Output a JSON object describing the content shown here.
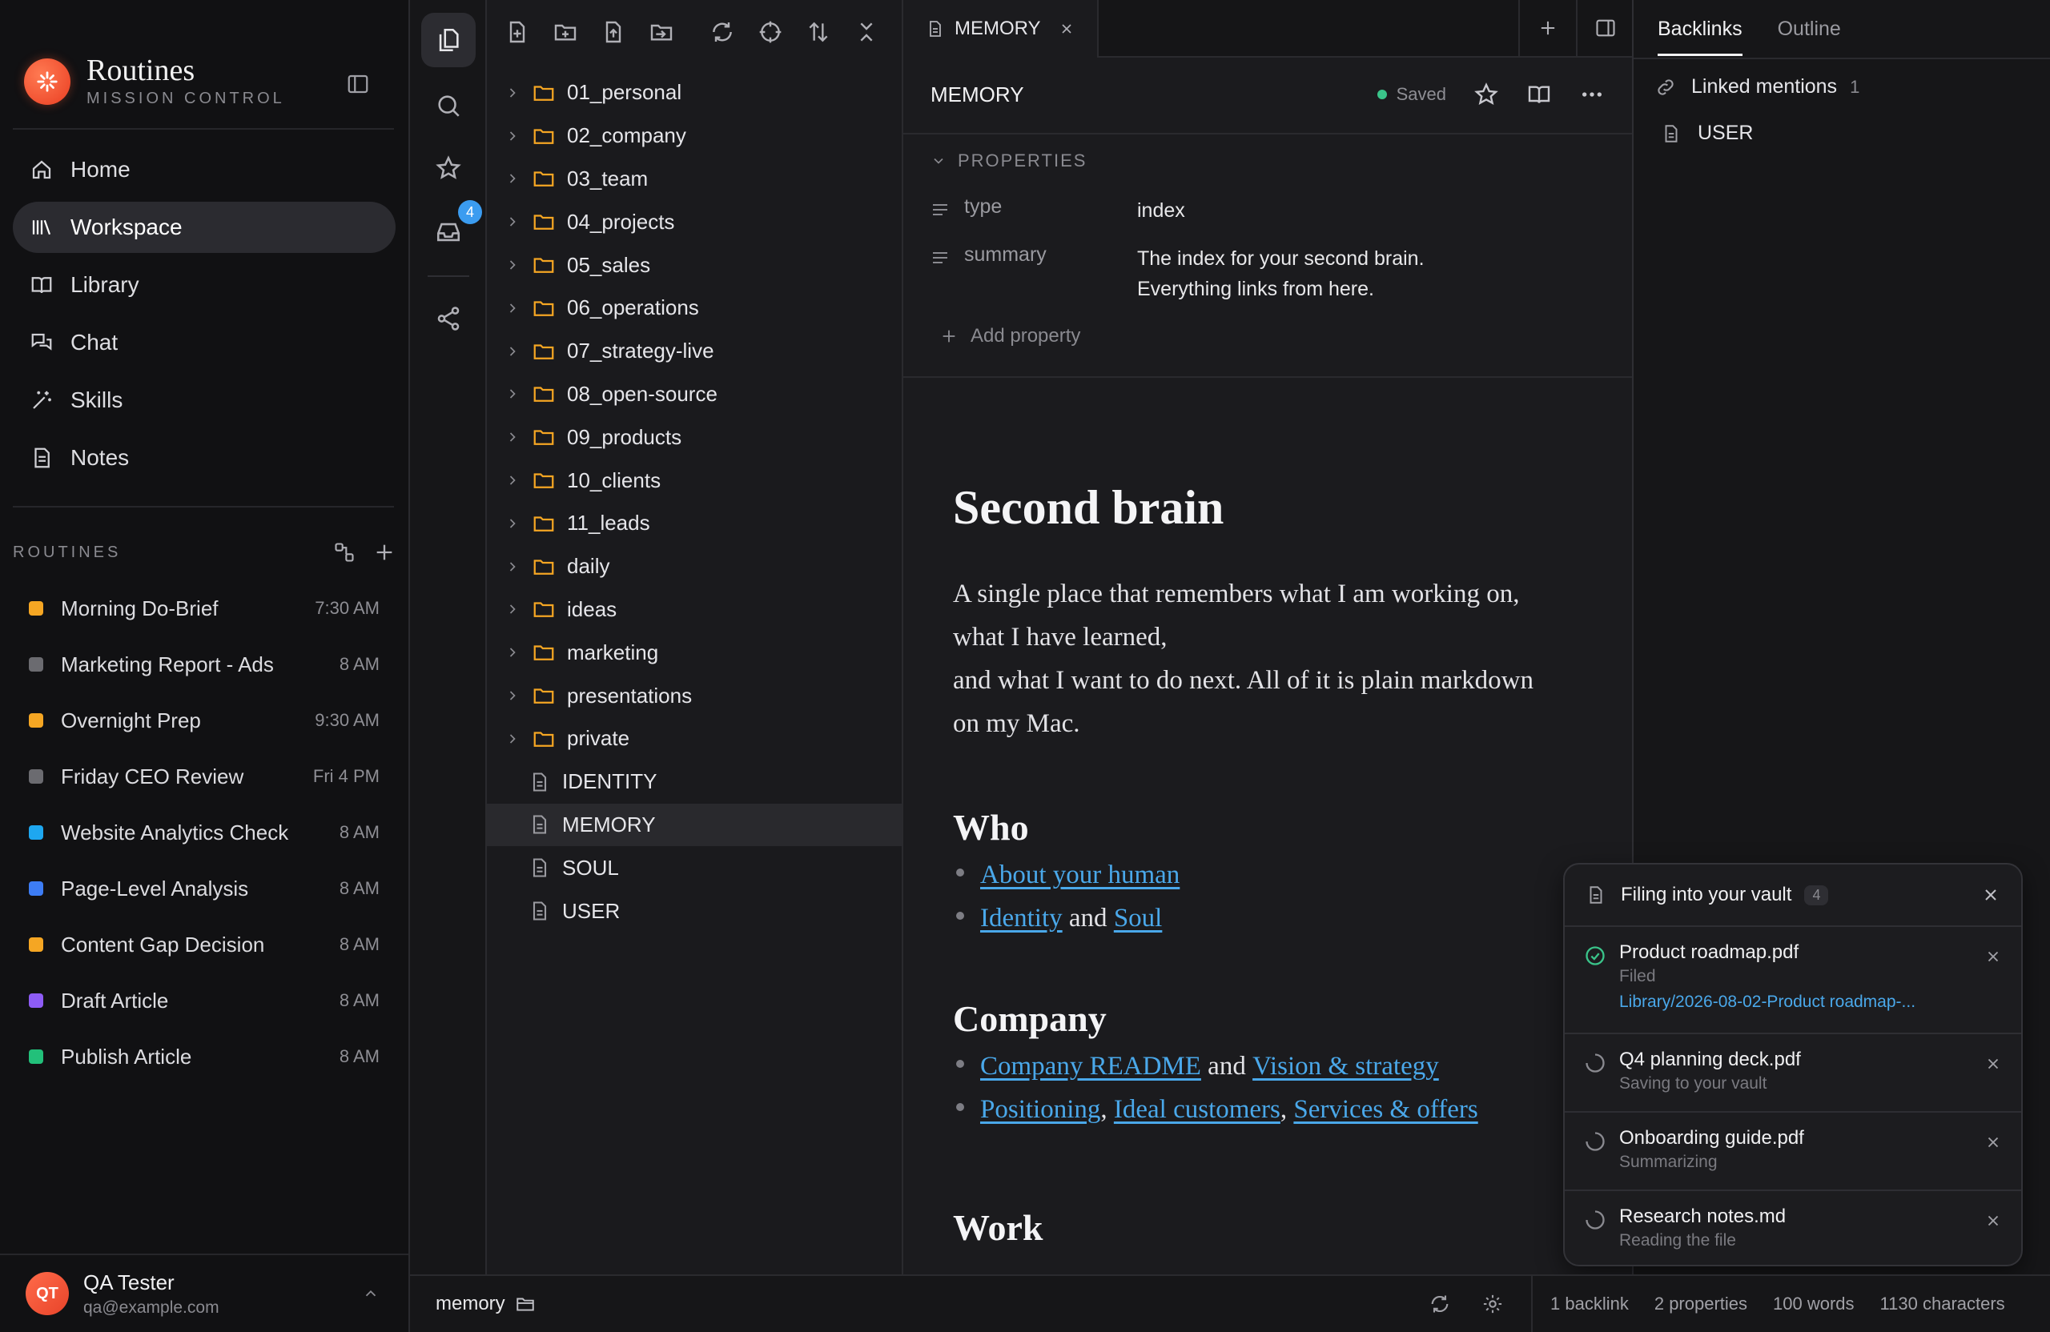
{
  "brand": {
    "title": "Routines",
    "subtitle": "MISSION CONTROL"
  },
  "nav": [
    {
      "label": "Home",
      "icon": "home-icon"
    },
    {
      "label": "Workspace",
      "icon": "library-books-icon",
      "active": true
    },
    {
      "label": "Library",
      "icon": "book-open-icon"
    },
    {
      "label": "Chat",
      "icon": "chat-bubbles-icon"
    },
    {
      "label": "Skills",
      "icon": "magic-wand-icon"
    },
    {
      "label": "Notes",
      "icon": "note-document-icon"
    }
  ],
  "routines": {
    "title": "ROUTINES",
    "items": [
      {
        "name": "Morning Do-Brief",
        "time": "7:30 AM",
        "color": "#f5a623"
      },
      {
        "name": "Marketing Report - Ads",
        "time": "8 AM",
        "color": "#6b6b70"
      },
      {
        "name": "Overnight Prep",
        "time": "9:30 AM",
        "color": "#f5a623"
      },
      {
        "name": "Friday CEO Review",
        "time": "Fri 4 PM",
        "color": "#6b6b70"
      },
      {
        "name": "Website Analytics Check",
        "time": "8 AM",
        "color": "#1ea7f0"
      },
      {
        "name": "Page-Level Analysis",
        "time": "8 AM",
        "color": "#3d7df5"
      },
      {
        "name": "Content Gap Decision",
        "time": "8 AM",
        "color": "#f5a623"
      },
      {
        "name": "Draft Article",
        "time": "8 AM",
        "color": "#8e5cf5"
      },
      {
        "name": "Publish Article",
        "time": "8 AM",
        "color": "#22c07a"
      }
    ]
  },
  "user": {
    "initials": "QT",
    "name": "QA Tester",
    "email": "qa@example.com"
  },
  "rail": {
    "inbox_badge": "4"
  },
  "explorer": {
    "folders": [
      "01_personal",
      "02_company",
      "03_team",
      "04_projects",
      "05_sales",
      "06_operations",
      "07_strategy-live",
      "08_open-source",
      "09_products",
      "10_clients",
      "11_leads",
      "daily",
      "ideas",
      "marketing",
      "presentations",
      "private"
    ],
    "files": [
      "IDENTITY",
      "MEMORY",
      "SOUL",
      "USER"
    ],
    "selected": "MEMORY"
  },
  "editor": {
    "tab_label": "MEMORY",
    "doc_title": "MEMORY",
    "saved_label": "Saved",
    "properties_label": "PROPERTIES",
    "properties": [
      {
        "key": "type",
        "value": "index"
      },
      {
        "key": "summary",
        "value_line1": "The index for your second brain.",
        "value_line2": "Everything links from here."
      }
    ],
    "add_property_label": "Add property",
    "body": {
      "h1": "Second brain",
      "intro": {
        "line1": "A single place that remembers what I am working on,",
        "line2": "what I have learned,",
        "line3": "and what I want to do next. All of it is plain markdown",
        "line4": "on my Mac."
      },
      "who_heading": "Who",
      "who_link1": "About your human",
      "who_link2": "Identity",
      "who_and": "and",
      "who_link3": "Soul",
      "company_heading": "Company",
      "company_link1": "Company README",
      "company_and": "and",
      "company_link2": "Vision & strategy",
      "company_link3": "Positioning",
      "company_link4": "Ideal customers",
      "company_link5": "Services & offers",
      "comma": ",",
      "next_heading": "Work"
    }
  },
  "right_panel": {
    "tabs": [
      "Backlinks",
      "Outline"
    ],
    "linked_mentions_label": "Linked mentions",
    "linked_mentions_count": "1",
    "backlinks": [
      "USER"
    ]
  },
  "toast": {
    "title": "Filing into your vault",
    "count": "4",
    "jobs": [
      {
        "name": "Product roadmap.pdf",
        "status": "Filed",
        "path": "Library/2026-08-02-Product roadmap-..."
      },
      {
        "name": "Q4 planning deck.pdf",
        "status": "Saving to your vault"
      },
      {
        "name": "Onboarding guide.pdf",
        "status": "Summarizing"
      },
      {
        "name": "Research notes.md",
        "status": "Reading the file"
      }
    ]
  },
  "statusbar": {
    "folder": "memory",
    "backlinks": "1 backlink",
    "properties": "2 properties",
    "words": "100 words",
    "characters": "1130 characters"
  },
  "colors": {
    "accent_link": "#4aa8ea",
    "brand": "#ea3e22",
    "saved_dot": "#3ac48a",
    "badge": "#3b9cf0"
  }
}
